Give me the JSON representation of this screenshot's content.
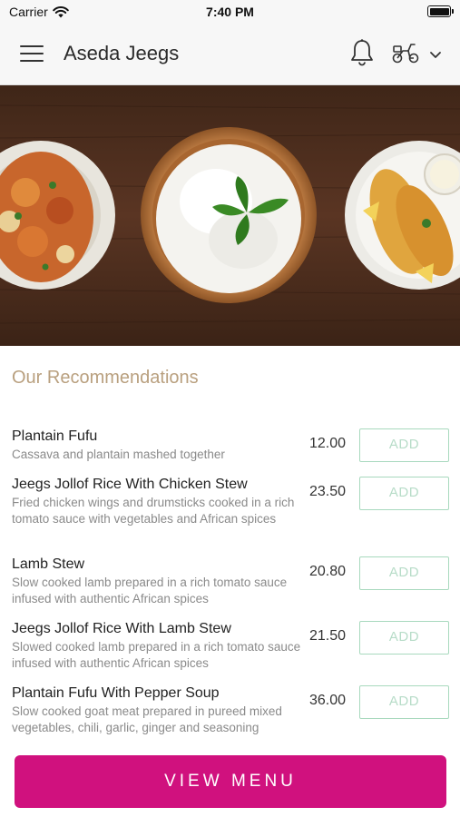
{
  "status_bar": {
    "carrier": "Carrier",
    "time": "7:40 PM"
  },
  "header": {
    "title": "Aseda Jeegs",
    "icons": [
      "menu-icon",
      "bell-icon",
      "moped-icon",
      "chevron-down-icon"
    ]
  },
  "hero": {
    "image": "dishes-on-wooden-table",
    "dishes": [
      "chicken-stew-plate",
      "rice-bowl",
      "fried-fish-plate"
    ]
  },
  "recommendations": {
    "heading": "Our Recommendations",
    "items": [
      {
        "name": "Plantain Fufu",
        "description": "Cassava and plantain mashed together",
        "price": "12.00",
        "add_label": "ADD"
      },
      {
        "name": "Jeegs Jollof Rice With Chicken Stew",
        "description": "Fried chicken wings and drumsticks cooked in a rich tomato sauce with vegetables and African spices",
        "price": "23.50",
        "add_label": "ADD"
      },
      {
        "name": "Lamb Stew",
        "description": "Slow cooked lamb prepared in a rich tomato sauce infused with authentic African spices",
        "price": "20.80",
        "add_label": "ADD"
      },
      {
        "name": "Jeegs Jollof Rice With Lamb Stew",
        "description": "Slowed cooked lamb prepared in a rich tomato sauce infused with authentic African spices",
        "price": "21.50",
        "add_label": "ADD"
      },
      {
        "name": "Plantain Fufu With Pepper Soup",
        "description": "Slow cooked goat meat prepared in pureed mixed vegetables, chili, garlic, ginger and seasoning",
        "price": "36.00",
        "add_label": "ADD"
      }
    ]
  },
  "cta": {
    "label": "VIEW MENU"
  },
  "colors": {
    "accent": "#d0117e",
    "heading": "#b9a07f",
    "add_border": "#a8d9be",
    "header_bg": "#f7f7f7"
  }
}
